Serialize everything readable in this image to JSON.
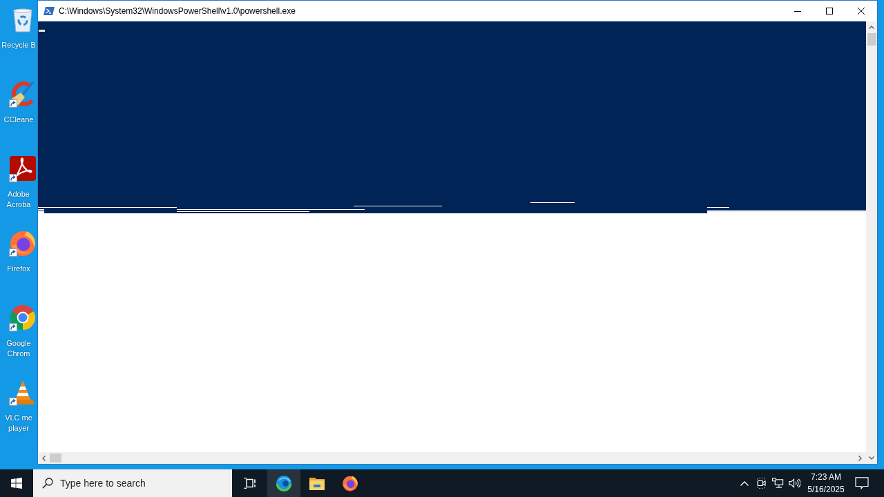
{
  "desktop": {
    "icons": [
      {
        "kind": "recycle-bin",
        "label": "Recycle B",
        "shortcut": false
      },
      {
        "kind": "ccleaner",
        "label": "CCleane",
        "shortcut": true
      },
      {
        "kind": "acrobat",
        "label": "Adobe Acroba",
        "shortcut": true
      },
      {
        "kind": "firefox",
        "label": "Firefox",
        "shortcut": true
      },
      {
        "kind": "chrome",
        "label": "Google Chrom",
        "shortcut": true
      },
      {
        "kind": "vlc",
        "label": "VLC me player",
        "shortcut": true
      }
    ]
  },
  "window": {
    "title": "C:\\Windows\\System32\\WindowsPowerShell\\v1.0\\powershell.exe"
  },
  "taskbar": {
    "search": {
      "placeholder": "Type here to search"
    },
    "apps": [
      {
        "kind": "edge",
        "selected": true
      },
      {
        "kind": "explorer",
        "selected": false
      },
      {
        "kind": "firefox",
        "selected": false
      }
    ],
    "clock": {
      "time": "7:23 AM",
      "date": "5/16/2025"
    }
  }
}
